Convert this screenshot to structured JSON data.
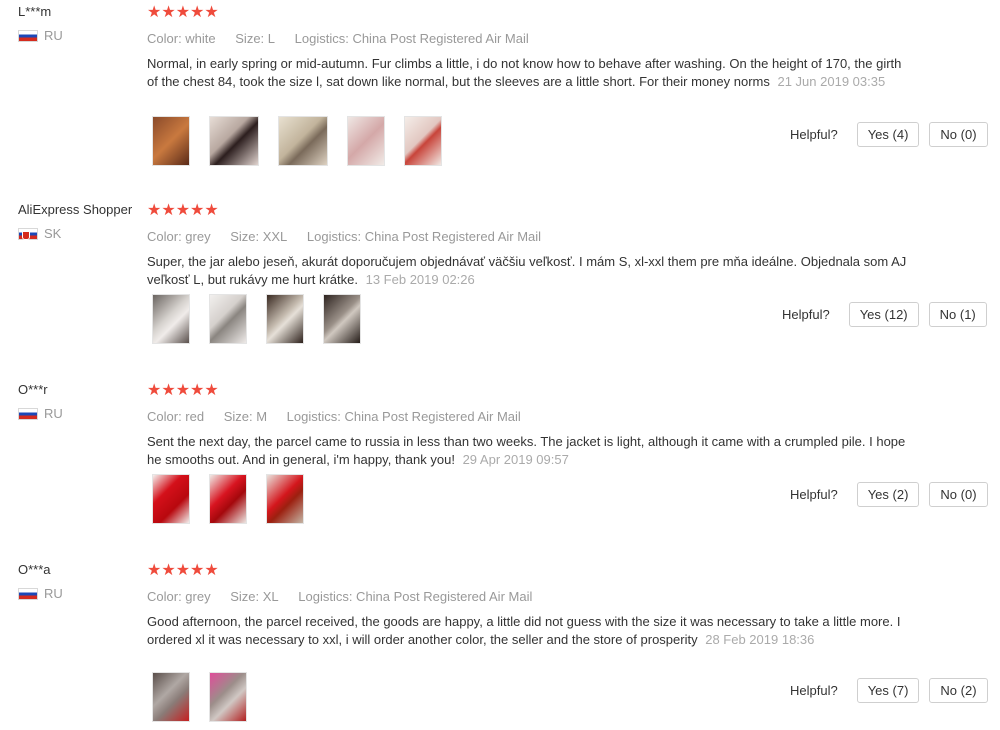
{
  "helpful_label": "Helpful?",
  "reviews": [
    {
      "user": "L***m",
      "country": "RU",
      "stars": "★★★★★",
      "color": "Color: white",
      "size": "Size: L",
      "logistics": "Logistics: China Post Registered Air Mail",
      "text": "Normal, in early spring or mid-autumn. Fur climbs a little, i do not know how to behave after washing. On the height of 170, the girth of the chest 84, took the size l, sat down like normal, but the sleeves are a little short. For their money norms",
      "date": "21 Jun 2019 03:35",
      "yes": "Yes (4)",
      "no": "No (0)"
    },
    {
      "user": "AliExpress Shopper",
      "country": "SK",
      "stars": "★★★★★",
      "color": "Color: grey",
      "size": "Size: XXL",
      "logistics": "Logistics: China Post Registered Air Mail",
      "text": "Super, the jar alebo jeseň, akurát doporučujem objednávať väčšiu veľkosť. I mám S, xl-xxl them pre mňa ideálne. Objednala som AJ veľkosť L, but rukávy me hurt krátke.",
      "date": "13 Feb 2019 02:26",
      "yes": "Yes (12)",
      "no": "No (1)"
    },
    {
      "user": "O***r",
      "country": "RU",
      "stars": "★★★★★",
      "color": "Color: red",
      "size": "Size: M",
      "logistics": "Logistics: China Post Registered Air Mail",
      "text": "Sent the next day, the parcel came to russia in less than two weeks. The jacket is light, although it came with a crumpled pile. I hope he smooths out. And in general, i'm happy, thank you!",
      "date": "29 Apr 2019 09:57",
      "yes": "Yes (2)",
      "no": "No (0)"
    },
    {
      "user": "O***a",
      "country": "RU",
      "stars": "★★★★★",
      "color": "Color: grey",
      "size": "Size: XL",
      "logistics": "Logistics: China Post Registered Air Mail",
      "text": "Good afternoon, the parcel received, the goods are happy, a little did not guess with the size it was necessary to take a little more. I ordered xl it was necessary to xxl, i will order another color, the seller and the store of prosperity",
      "date": "28 Feb 2019 18:36",
      "yes": "Yes (7)",
      "no": "No (2)"
    }
  ],
  "colors": {
    "star": "#ef4b3c",
    "meta": "#999999",
    "date": "#aaaaaa"
  }
}
